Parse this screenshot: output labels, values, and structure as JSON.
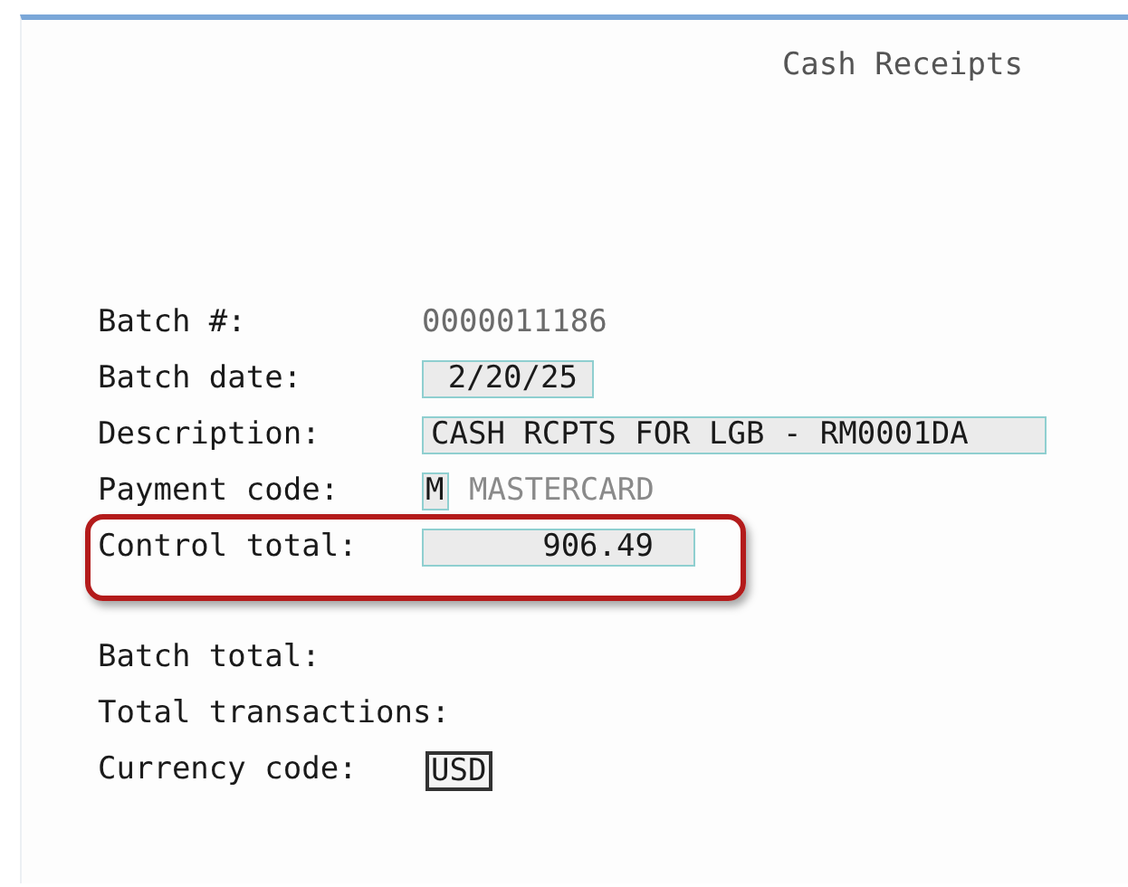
{
  "title": "Cash Receipts",
  "groups": [
    {
      "rows": [
        {
          "label": "Batch #:",
          "kind": "display",
          "value": "0000011186",
          "highlighted": false
        },
        {
          "label": "Batch date:",
          "kind": "date",
          "value": "2/20/25",
          "highlighted": false
        },
        {
          "label": "Description:",
          "kind": "text",
          "value": "CASH RCPTS FOR LGB - RM0001DA",
          "highlighted": false
        },
        {
          "label": "Payment code:",
          "kind": "code",
          "value": "M",
          "description": "MASTERCARD",
          "highlighted": false
        },
        {
          "label": "Control total:",
          "kind": "amount",
          "value": "906.49",
          "highlighted": true
        }
      ]
    },
    {
      "rows": [
        {
          "label": "Batch total:",
          "kind": "empty",
          "highlighted": false
        },
        {
          "label": "Total transactions:",
          "kind": "empty",
          "highlighted": false
        },
        {
          "label": "Currency code:",
          "kind": "currency",
          "value": "USD",
          "highlighted": false
        }
      ]
    }
  ]
}
